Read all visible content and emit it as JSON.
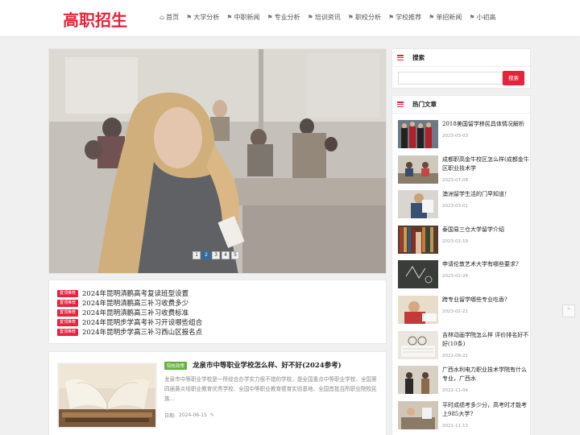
{
  "site": {
    "logo": "高职招生"
  },
  "nav": [
    {
      "label": "首页",
      "icon": "home-icon",
      "glyph": "⌂"
    },
    {
      "label": "大学分析",
      "icon": "tag-icon",
      "glyph": "⚑"
    },
    {
      "label": "中职新闻",
      "icon": "tag-icon",
      "glyph": "⚑"
    },
    {
      "label": "专业分析",
      "icon": "tag-icon",
      "glyph": "⚑"
    },
    {
      "label": "培训资讯",
      "icon": "tag-icon",
      "glyph": "⚑"
    },
    {
      "label": "职校分析",
      "icon": "tag-icon",
      "glyph": "⚑"
    },
    {
      "label": "学校推荐",
      "icon": "tag-icon",
      "glyph": "⚑"
    },
    {
      "label": "单招新闻",
      "icon": "tag-icon",
      "glyph": "⚑"
    },
    {
      "label": "小初高",
      "icon": "tag-icon",
      "glyph": "⚑"
    }
  ],
  "slider": {
    "pages": [
      "1",
      "2",
      "3",
      "4",
      "5"
    ],
    "active_index": 1
  },
  "notices": [
    {
      "tag": "置顶推荐",
      "text": "2024年昆明滇鹏高考复读班型设置"
    },
    {
      "tag": "置顶推荐",
      "text": "2024年昆明滇鹏高三补习收费多少"
    },
    {
      "tag": "置顶推荐",
      "text": "2024年昆明滇鹏高三补习收费标准"
    },
    {
      "tag": "置顶推荐",
      "text": "2024年昆明步学高考补习开设哪些组合"
    },
    {
      "tag": "置顶推荐",
      "text": "2024年昆明步学高三补习西山区报名点"
    }
  ],
  "article": {
    "category": "院校政策",
    "title": "龙泉市中等职业学校怎么样、好不好(2024参考)",
    "summary": "龙泉市中等职业学校是一所综合办学实力很不错的学校，是全国重点中等职业学校、全国第四届黄炎培职业教育优秀学校、全国中等职业教育德育实验基地、全国首批百所职业院校民族...",
    "date_label": "日期:",
    "date": "2024-06-15"
  },
  "search": {
    "title": "搜索",
    "placeholder": "",
    "button": "搜索"
  },
  "hot": {
    "title": "热门文章",
    "items": [
      {
        "title": "2018美国留学移民具体情况解析",
        "date": "2023-03-03"
      },
      {
        "title": "成都职高金牛校区怎么样(成都金牛区职业技术学",
        "date": "2023-07-08"
      },
      {
        "title": "澳洲留学生活的门早知道！",
        "date": "2023-03-01"
      },
      {
        "title": "泰国易三仓大学留学介绍",
        "date": "2023-02-19"
      },
      {
        "title": "申请伦敦艺术大学有哪些要求?",
        "date": "2023-02-24"
      },
      {
        "title": "跨专业留学哪些专业吃香?",
        "date": "2023-02-21"
      },
      {
        "title": "吉林动画学院怎么样 评价排名好不好(10条)",
        "date": "2021-08-21"
      },
      {
        "title": "广西水利电力职业技术学院有什么专业，广西水",
        "date": "2022-11-04"
      },
      {
        "title": "平时成绩考多少分，高考时才能考上985大学?",
        "date": "2021-11-13"
      }
    ]
  },
  "colors": {
    "brand": "#e5243b",
    "category": "#5fb33d",
    "page_active": "#2d6da3"
  }
}
